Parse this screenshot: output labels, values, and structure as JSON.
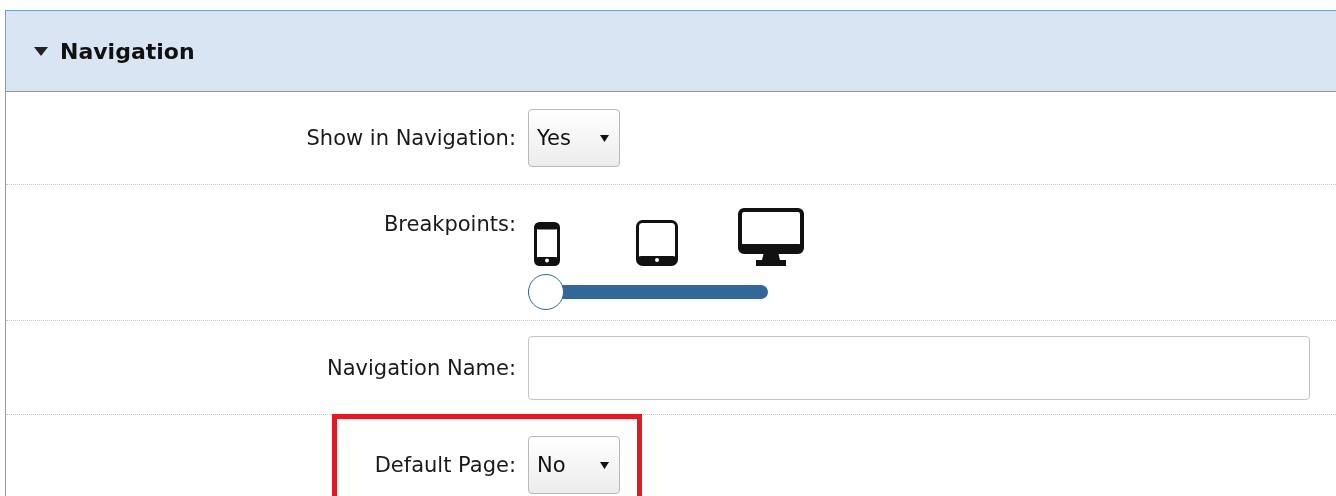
{
  "panel": {
    "title": "Navigation",
    "expanded": true
  },
  "fields": [
    {
      "kind": "select",
      "label": "Show in Navigation:",
      "value": "Yes"
    },
    {
      "kind": "breakpoints",
      "label": "Breakpoints:",
      "level": 0
    },
    {
      "kind": "text",
      "label": "Navigation Name:"
    },
    {
      "kind": "select",
      "label": "Default Page:",
      "value": "No",
      "highlighted": true
    }
  ]
}
